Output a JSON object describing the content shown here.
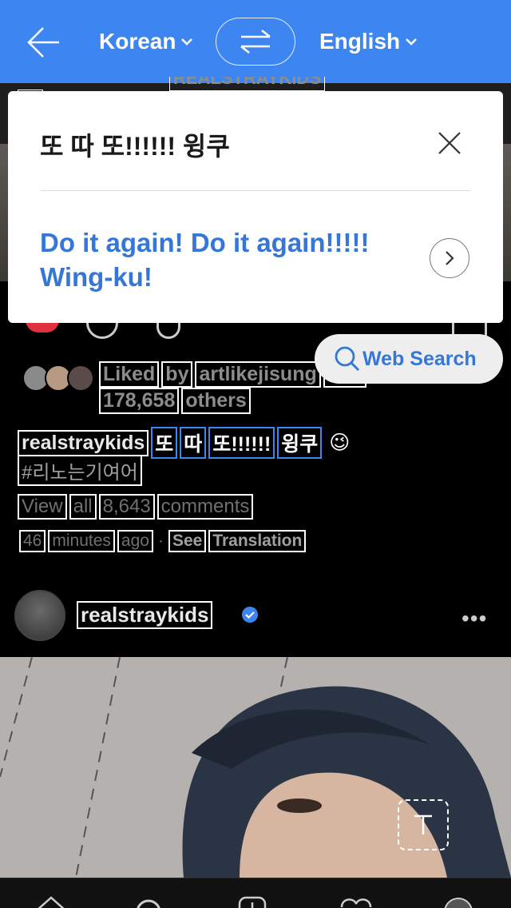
{
  "toolbar": {
    "source_language": "Korean",
    "target_language": "English"
  },
  "translation_card": {
    "source_text": "또 따 또!!!!!! 윙쿠",
    "translated_text": "Do it again! Do it again!!!!! Wing-ku!"
  },
  "web_search": {
    "label": "Web Search"
  },
  "feed": {
    "header_username": "REALSTRAYKIDS",
    "likes_words": [
      "Liked",
      "by",
      "artlikejisung",
      "and"
    ],
    "likes_words_line2": [
      "178,658",
      "others"
    ],
    "caption": {
      "username": "realstraykids",
      "words": [
        "또",
        "따",
        "또!!!!!!",
        "윙쿠"
      ],
      "emoji": "😉",
      "hashtag": "#리노는기여어"
    },
    "comments_words": [
      "View",
      "all",
      "8,643",
      "comments"
    ],
    "time_words": [
      "46",
      "minutes",
      "ago"
    ],
    "time_separator": "·",
    "see_translation_words": [
      "See",
      "Translation"
    ],
    "post": {
      "username": "realstraykids",
      "more_label": "•••"
    }
  },
  "icons": {
    "back": "arrow-left-icon",
    "swap": "swap-arrows-icon",
    "close": "close-icon",
    "next": "chevron-right-icon",
    "search": "search-icon",
    "text_select": "text-select-icon",
    "verified": "verified-badge-icon"
  },
  "colors": {
    "accent": "#3d86f2",
    "link": "#3577d8",
    "background": "#000000",
    "heart": "#e0303d"
  }
}
